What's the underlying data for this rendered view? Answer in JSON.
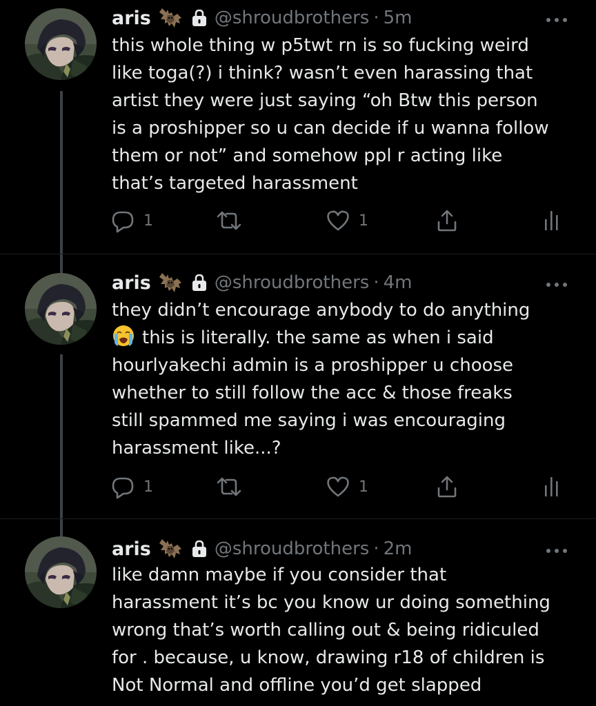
{
  "tweets": [
    {
      "name": "aris",
      "handle": "@shroudbrothers",
      "separator": "·",
      "time": "5m",
      "text": "this whole thing w p5twt rn is so fucking weird\nlike toga(?) i think? wasn’t even harassing that\nartist they were just saying “oh Btw this person\nis a proshipper so u can decide if u wanna follow\nthem or not” and somehow ppl r acting like\nthat’s targeted harassment",
      "replies": "1",
      "likes": "1"
    },
    {
      "name": "aris",
      "handle": "@shroudbrothers",
      "separator": "·",
      "time": "4m",
      "text_first": "they didn’t encourage anybody to do anything",
      "emoji": "loudly-crying-face",
      "text_rest": "this is literally. the same as when i said\nhourlyakechi admin is a proshipper u choose\nwhether to still follow the acc & those freaks\nstill spammed me saying i was encouraging\nharassment like...?",
      "replies": "1",
      "likes": "1"
    },
    {
      "name": "aris",
      "handle": "@shroudbrothers",
      "separator": "·",
      "time": "2m",
      "text": "like damn maybe if you consider that\nharassment it’s bc you know ur doing something\nwrong that’s worth calling out & being ridiculed\nfor . because, u know, drawing r18 of children is\nNot Normal and offline you’d get slapped"
    }
  ],
  "icons": {
    "name_badge": "bat-icon",
    "protected": "lock-icon",
    "more": "more-icon",
    "reply": "reply-icon",
    "retweet": "retweet-icon",
    "like": "heart-icon",
    "share": "share-icon",
    "analytics": "analytics-icon"
  },
  "colors": {
    "background": "#000000",
    "text": "#e7e9ea",
    "secondary": "#71767b",
    "thread_line": "#3d4145"
  }
}
